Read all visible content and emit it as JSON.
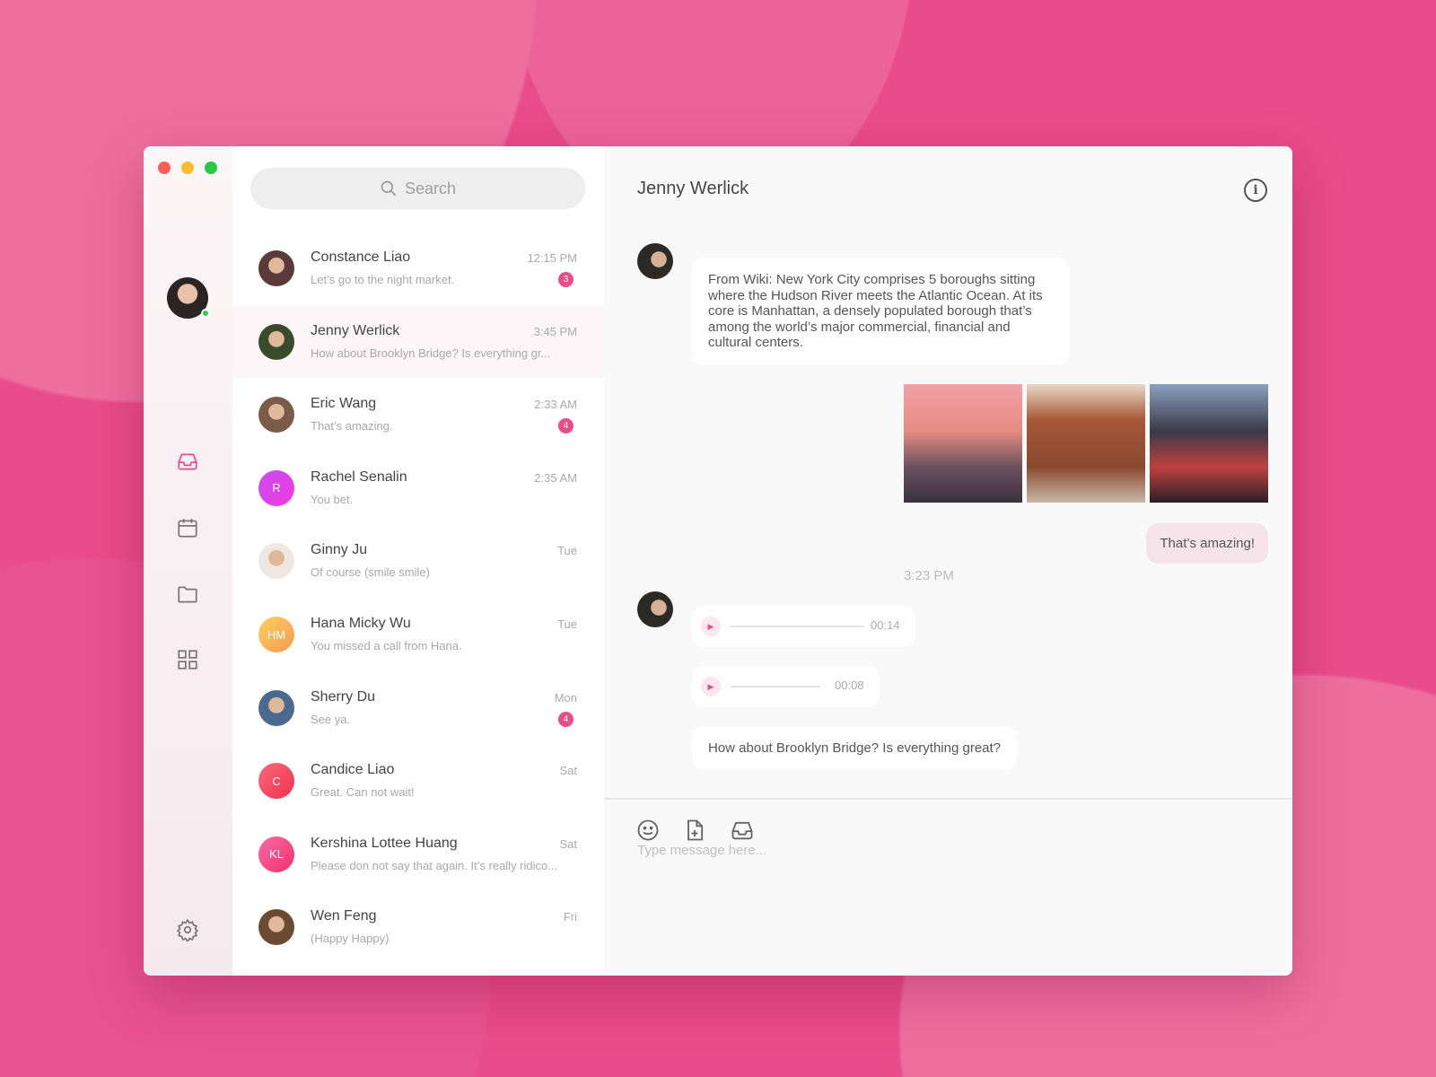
{
  "window": {
    "controls": [
      "close",
      "minimize",
      "maximize"
    ]
  },
  "sidebar": {
    "nav": [
      "inbox-icon",
      "calendar-icon",
      "folder-icon",
      "grid-icon",
      "gear-icon"
    ],
    "accent": "#ea4c89"
  },
  "search": {
    "placeholder": "Search"
  },
  "conversations": [
    {
      "name": "Constance Liao",
      "preview": "Let’s go to the night market.",
      "time": "12:15 PM",
      "badge": "3"
    },
    {
      "name": "Jenny Werlick",
      "preview": "How about Brooklyn Bridge? Is everything gr...",
      "time": "3:45 PM",
      "badge": ""
    },
    {
      "name": "Eric Wang",
      "preview": "That’s amazing.",
      "time": "2:33 AM",
      "badge": "4"
    },
    {
      "name": "Rachel Senalin",
      "preview": "You bet.",
      "time": "2:35 AM",
      "badge": "",
      "initials": "R"
    },
    {
      "name": "Ginny Ju",
      "preview": "Of course (smile smile)",
      "time": "Tue",
      "badge": ""
    },
    {
      "name": "Hana Micky Wu",
      "preview": "You missed a call from Hana.",
      "time": "Tue",
      "badge": "",
      "initials": "HM"
    },
    {
      "name": "Sherry Du",
      "preview": "See ya.",
      "time": "Mon",
      "badge": "4"
    },
    {
      "name": "Candice Liao",
      "preview": "Great. Can not wait!",
      "time": "Sat",
      "badge": "",
      "initials": "C"
    },
    {
      "name": "Kershina Lottee Huang",
      "preview": "Please don not say that again. It’s really ridico...",
      "time": "Sat",
      "badge": "",
      "initials": "KL"
    },
    {
      "name": "Wen Feng",
      "preview": "(Happy Happy)",
      "time": "Fri",
      "badge": ""
    }
  ],
  "chat": {
    "title": "Jenny Werlick",
    "wiki": "From Wiki: New York City comprises 5 boroughs sitting where the Hudson River meets the Atlantic Ocean. At its core is Manhattan, a densely populated borough that’s among the world’s major commercial, financial and cultural centers.",
    "reply": "That’s amazing!",
    "timestamp": "3:23 PM",
    "audio1": "00:14",
    "audio2": "00:08",
    "last": "How about Brooklyn Bridge? Is everything great?",
    "input_placeholder": "Type message here..."
  }
}
